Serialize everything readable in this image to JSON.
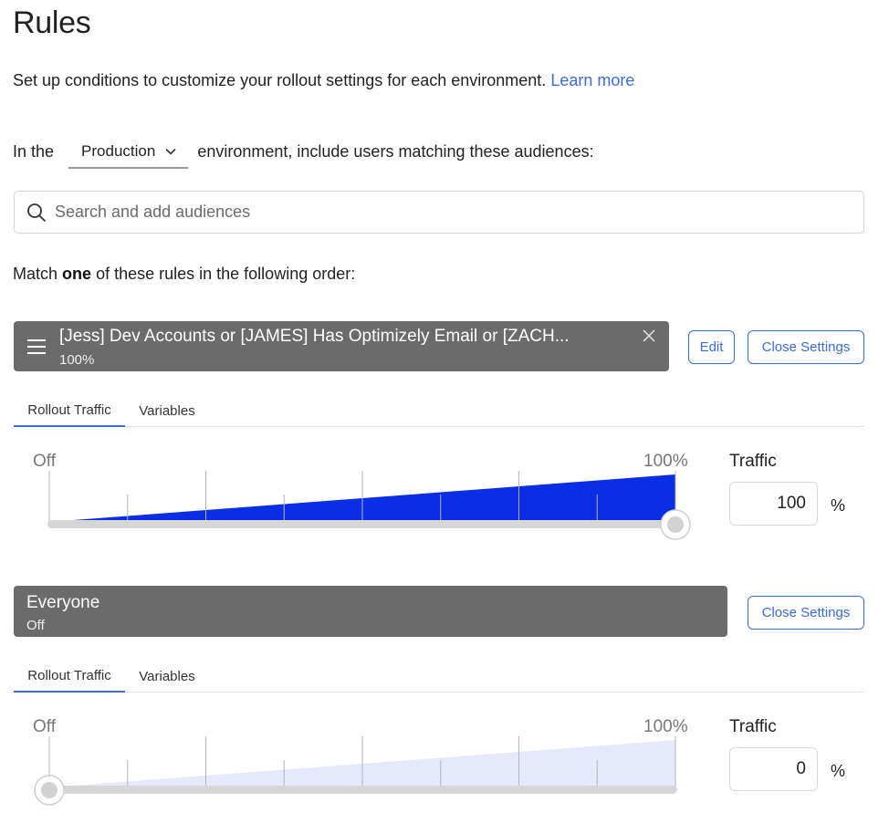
{
  "page": {
    "title": "Rules",
    "intro_text": "Set up conditions to customize your rollout settings for each environment.",
    "learn_more": "Learn more"
  },
  "environment": {
    "prefix": "In the",
    "selected": "Production",
    "suffix": "environment, include users matching these audiences:"
  },
  "search": {
    "placeholder": "Search and add audiences"
  },
  "match": {
    "prefix": "Match",
    "bold": "one",
    "suffix": "of these rules in the following order:"
  },
  "rules": [
    {
      "name": "[Jess] Dev Accounts or [JAMES] Has Optimizely Email or [ZACH...",
      "status": "100%",
      "edit_label": "Edit",
      "close_settings_label": "Close Settings",
      "tabs": [
        "Rollout Traffic",
        "Variables"
      ],
      "slider_min_label": "Off",
      "slider_max_label": "100%",
      "traffic_label": "Traffic",
      "traffic_value": "100",
      "traffic_unit": "%",
      "traffic_fraction": 1.0
    },
    {
      "name": "Everyone",
      "status": "Off",
      "close_settings_label": "Close Settings",
      "tabs": [
        "Rollout Traffic",
        "Variables"
      ],
      "slider_min_label": "Off",
      "slider_max_label": "100%",
      "traffic_label": "Traffic",
      "traffic_value": "0",
      "traffic_unit": "%",
      "traffic_fraction": 0.0
    }
  ],
  "colors": {
    "accent": "#3b6bdc",
    "rule_bar": "#6b6b6b",
    "slider_fill_on": "#0a2ee6",
    "slider_fill_off": "#e6e8fb"
  },
  "icons": {
    "search": "search-icon",
    "dropdown": "chevron-down-icon",
    "drag": "drag-handle-icon",
    "remove": "close-icon"
  }
}
